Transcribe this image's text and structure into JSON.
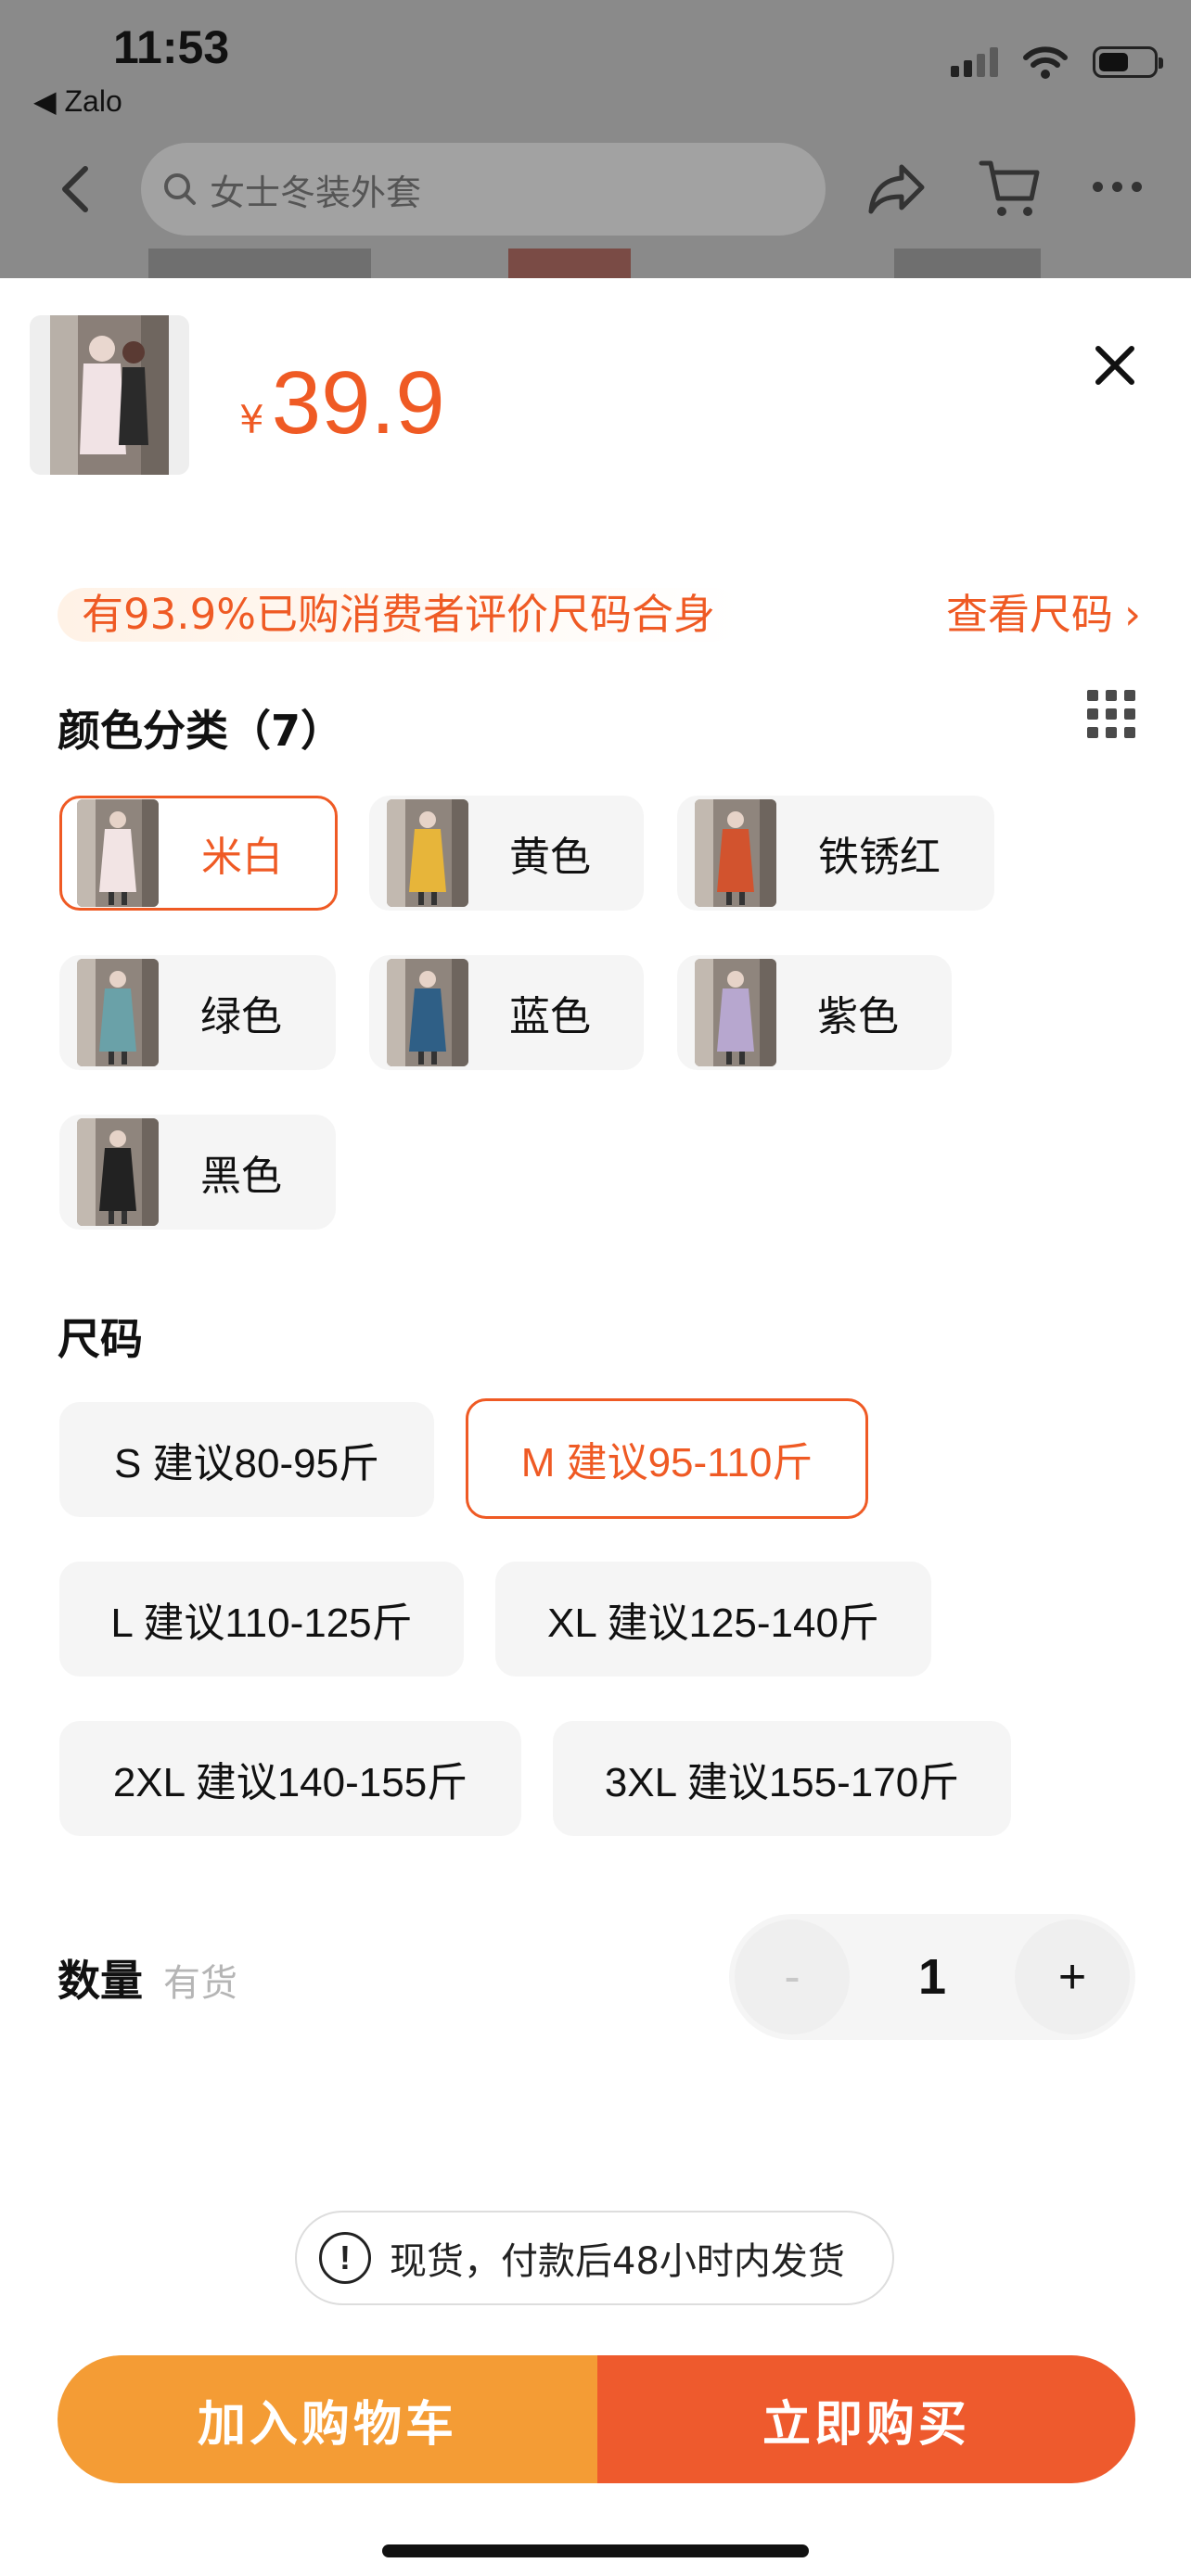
{
  "status_bar": {
    "time": "11:53",
    "back_app": "◀ Zalo",
    "battery_level": 0.55
  },
  "nav": {
    "search_placeholder": "女士冬装外套",
    "icons": [
      "back-chevron-icon",
      "search-icon",
      "share-icon",
      "cart-icon",
      "more-icon"
    ]
  },
  "product": {
    "currency": "¥",
    "price": "39.9",
    "thumbnail_icon": "product-photo"
  },
  "fit_tip": "有93.9%已购消费者评价尺码合身",
  "size_guide": {
    "label": "查看尺码",
    "chevron": "›"
  },
  "color_section": {
    "title": "颜色分类（7）",
    "options": [
      {
        "label": "米白",
        "selected": true,
        "coat_color": "#f2e4e4"
      },
      {
        "label": "黄色",
        "selected": false,
        "coat_color": "#e7b53a"
      },
      {
        "label": "铁锈红",
        "selected": false,
        "coat_color": "#d2532e"
      },
      {
        "label": "绿色",
        "selected": false,
        "coat_color": "#6aa1a8"
      },
      {
        "label": "蓝色",
        "selected": false,
        "coat_color": "#2f5f86"
      },
      {
        "label": "紫色",
        "selected": false,
        "coat_color": "#b7a7cf"
      },
      {
        "label": "黑色",
        "selected": false,
        "coat_color": "#222222"
      }
    ]
  },
  "size_section": {
    "title": "尺码",
    "options": [
      {
        "label": "S 建议80-95斤",
        "selected": false
      },
      {
        "label": "M 建议95-110斤",
        "selected": true
      },
      {
        "label": "L 建议110-125斤",
        "selected": false
      },
      {
        "label": "XL 建议125-140斤",
        "selected": false
      },
      {
        "label": "2XL 建议140-155斤",
        "selected": false
      },
      {
        "label": "3XL 建议155-170斤",
        "selected": false
      }
    ]
  },
  "quantity": {
    "label": "数量",
    "stock": "有货",
    "minus": "-",
    "plus": "+",
    "value": "1"
  },
  "shipping_note": {
    "icon": "!",
    "text": "现货，付款后48小时内发货"
  },
  "actions": {
    "add_to_cart": "加入购物车",
    "buy_now": "立即购买"
  },
  "colors": {
    "accent": "#ef5a24",
    "cart_button": "#f49c35",
    "buy_button": "#ee5a2d",
    "chip_bg": "#f5f5f5"
  }
}
